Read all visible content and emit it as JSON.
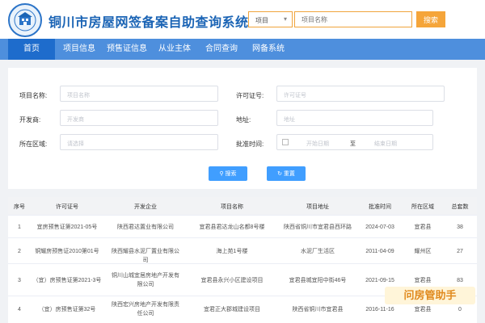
{
  "header": {
    "title": "铜川市房屋网签备案自助查询系统",
    "search": {
      "type_value": "项目",
      "placeholder": "项目名称",
      "button": "搜索"
    }
  },
  "nav": [
    "首页",
    "项目信息",
    "预售证信息",
    "从业主体",
    "合同查询",
    "网备系统"
  ],
  "form": {
    "project_name": {
      "label": "项目名称:",
      "placeholder": "项目名称"
    },
    "license_no": {
      "label": "许可证号:",
      "placeholder": "许可证号"
    },
    "developer": {
      "label": "开发商:",
      "placeholder": "开发商"
    },
    "address": {
      "label": "地址:",
      "placeholder": "地址"
    },
    "region": {
      "label": "所在区域:",
      "placeholder": "请选择"
    },
    "approval_time": {
      "label": "批准时间:",
      "start_placeholder": "开始日期",
      "separator": "至",
      "end_placeholder": "结束日期"
    },
    "search_button": "搜索",
    "reset_button": "重置"
  },
  "table": {
    "headers": [
      "序号",
      "许可证号",
      "开发企业",
      "项目名称",
      "项目地址",
      "批准时间",
      "所在区域",
      "总套数"
    ],
    "rows": [
      [
        "1",
        "宜房预售证第2021-05号",
        "陕西君达置业有限公司",
        "宜君县君达龙山名都8号楼",
        "陕西省铜川市宜君县西环路",
        "2024-07-03",
        "宜君县",
        "38"
      ],
      [
        "2",
        "铜耀房预售证2010第01号",
        "陕西耀县水泥厂置业有限公司",
        "海上苑1号楼",
        "水泥厂生活区",
        "2011-04-09",
        "耀州区",
        "27"
      ],
      [
        "3",
        "（宜）房预售证第2021-3号",
        "铜川山城宜居房地产开发有限公司",
        "宜君县永兴小区建设项目",
        "宜君县城宜阳中街46号",
        "2021-09-15",
        "宜君县",
        "83"
      ],
      [
        "4",
        "（宜）房预售证第32号",
        "陕西宏兴房地产开发有限责任公司",
        "宜君正大郡城建设项目",
        "陕西省铜川市宜君县",
        "2016-11-16",
        "宜君县",
        "0"
      ]
    ]
  },
  "watermark": "问房管助手",
  "colors": {
    "brand": "#1b64b5",
    "nav": "#4e8fdd",
    "accent": "#f5a53a",
    "primary_button": "#409eff"
  },
  "icons": [
    "logo-emblem-icon",
    "chevron-down-icon",
    "calendar-icon",
    "search-icon",
    "refresh-icon"
  ]
}
